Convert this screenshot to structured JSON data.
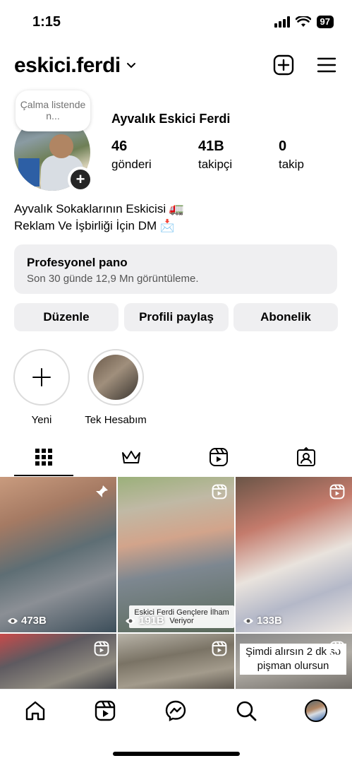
{
  "status_bar": {
    "time": "1:15",
    "battery": "97"
  },
  "header": {
    "username": "eskici.ferdi"
  },
  "profile": {
    "note": "Çalma listende n...",
    "full_name": "Ayvalık Eskici Ferdi",
    "stats": [
      {
        "value": "46",
        "label": "gönderi"
      },
      {
        "value": "41B",
        "label": "takipçi"
      },
      {
        "value": "0",
        "label": "takip"
      }
    ],
    "bio_line1": "Ayvalık Sokaklarının Eskicisi 🚛",
    "bio_line2": "Reklam Ve İşbirliği İçin DM 📩"
  },
  "pro_dashboard": {
    "title": "Profesyonel pano",
    "subtitle": "Son 30 günde 12,9 Mn görüntüleme."
  },
  "actions": {
    "edit": "Düzenle",
    "share": "Profili paylaş",
    "subscribe": "Abonelik"
  },
  "highlights": [
    {
      "label": "Yeni"
    },
    {
      "label": "Tek Hesabım"
    }
  ],
  "tabs": [
    "grid-icon",
    "crown-icon",
    "reels-icon",
    "tagged-icon"
  ],
  "posts": [
    {
      "views": "473B"
    },
    {
      "views": "191B",
      "caption": "Eskici Ferdi Gençlere İlham Veriyor"
    },
    {
      "views": "133B"
    },
    {},
    {},
    {
      "caption": "Şimdi alırsın 2 dk so\npişman olursun"
    }
  ],
  "colors": {
    "surface": "#efeff1",
    "text": "#000000",
    "muted": "#737373"
  }
}
